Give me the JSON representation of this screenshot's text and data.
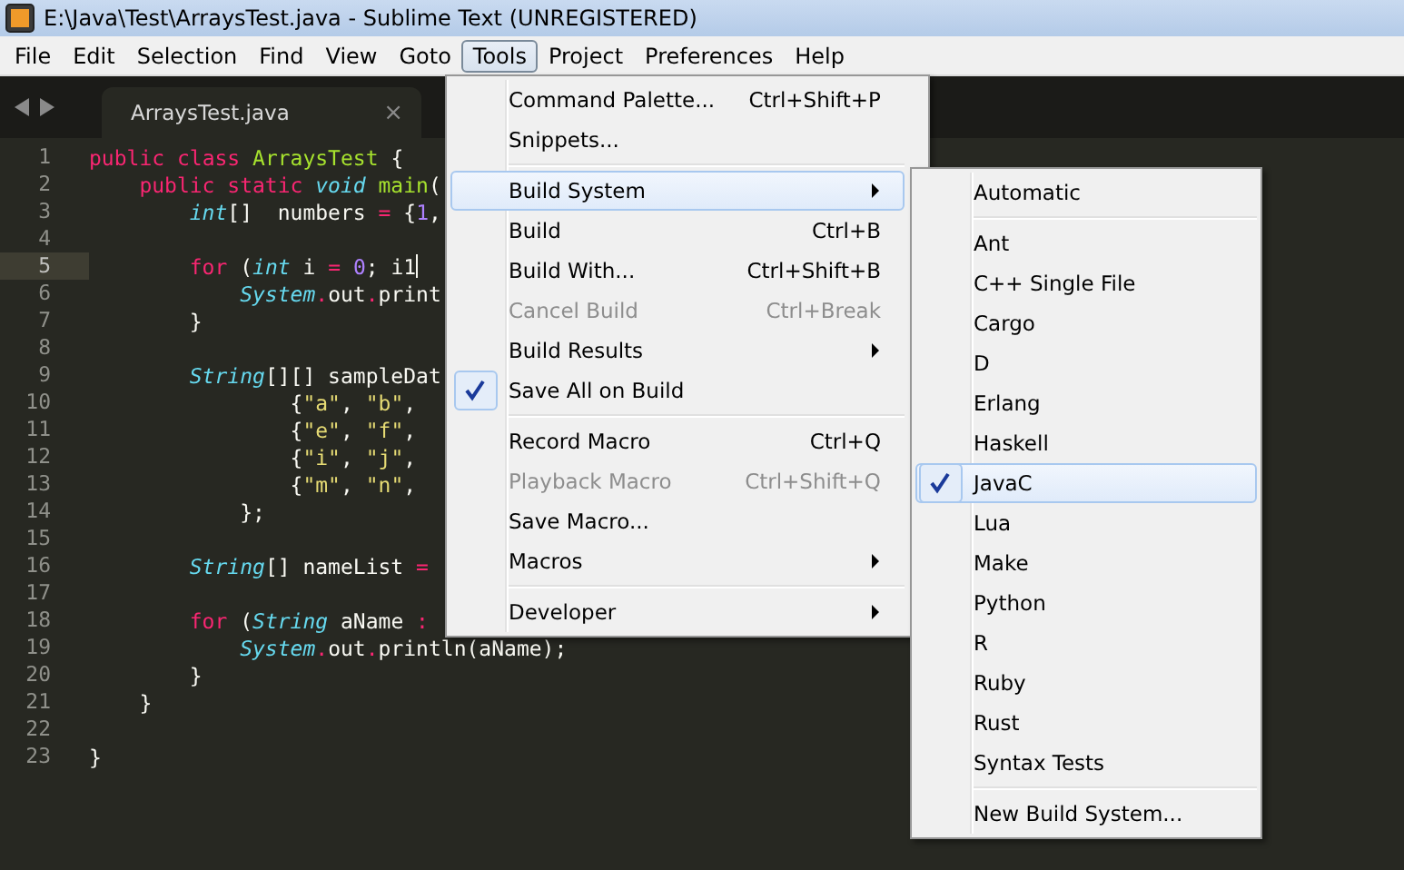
{
  "window": {
    "title": "E:\\Java\\Test\\ArraysTest.java - Sublime Text (UNREGISTERED)"
  },
  "menubar": [
    {
      "label": "File",
      "selected": false
    },
    {
      "label": "Edit",
      "selected": false
    },
    {
      "label": "Selection",
      "selected": false
    },
    {
      "label": "Find",
      "selected": false
    },
    {
      "label": "View",
      "selected": false
    },
    {
      "label": "Goto",
      "selected": false
    },
    {
      "label": "Tools",
      "selected": true
    },
    {
      "label": "Project",
      "selected": false
    },
    {
      "label": "Preferences",
      "selected": false
    },
    {
      "label": "Help",
      "selected": false
    }
  ],
  "tabs": [
    {
      "label": "ArraysTest.java",
      "selected": true,
      "close": "×"
    }
  ],
  "editor": {
    "lines": [
      {
        "number": "1",
        "current": false,
        "tokens": [
          {
            "kind": "kw",
            "text": "public"
          },
          {
            "kind": "kw",
            "text": " class"
          },
          {
            "kind": "fn",
            "text": " ArraysTest"
          },
          {
            "kind": "plain",
            "text": " {"
          }
        ]
      },
      {
        "number": "2",
        "current": false,
        "tokens": [
          {
            "kind": "kw",
            "text": "    public static"
          },
          {
            "kind": "type",
            "text": " void"
          },
          {
            "kind": "fn",
            "text": " main"
          },
          {
            "kind": "plain",
            "text": "("
          }
        ]
      },
      {
        "number": "3",
        "current": false,
        "tokens": [
          {
            "kind": "type",
            "text": "        int"
          },
          {
            "kind": "plain",
            "text": "[]  numbers"
          },
          {
            "kind": "kw",
            "text": " ="
          },
          {
            "kind": "plain",
            "text": " {"
          },
          {
            "kind": "num",
            "text": "1"
          },
          {
            "kind": "plain",
            "text": ","
          }
        ]
      },
      {
        "number": "4",
        "current": false
      },
      {
        "number": "5",
        "current": true,
        "tokens": [
          {
            "kind": "kw",
            "text": "        for"
          },
          {
            "kind": "plain",
            "text": " ("
          },
          {
            "kind": "type",
            "text": "int"
          },
          {
            "kind": "plain",
            "text": " i"
          },
          {
            "kind": "kw",
            "text": " ="
          },
          {
            "kind": "num",
            "text": " 0"
          },
          {
            "kind": "plain",
            "text": "; i1"
          }
        ]
      },
      {
        "number": "6",
        "current": false,
        "tokens": [
          {
            "kind": "type",
            "text": "            System"
          },
          {
            "kind": "kw",
            "text": "."
          },
          {
            "kind": "plain",
            "text": "out"
          },
          {
            "kind": "kw",
            "text": "."
          },
          {
            "kind": "plain",
            "text": "print"
          }
        ]
      },
      {
        "number": "7",
        "current": false,
        "tokens": [
          {
            "kind": "plain",
            "text": "        }"
          }
        ]
      },
      {
        "number": "8",
        "current": false
      },
      {
        "number": "9",
        "current": false,
        "tokens": [
          {
            "kind": "type",
            "text": "        String"
          },
          {
            "kind": "plain",
            "text": "[][] sampleDat"
          }
        ]
      },
      {
        "number": "10",
        "current": false,
        "tokens": [
          {
            "kind": "plain",
            "text": "                {"
          },
          {
            "kind": "str",
            "text": "\"a\""
          },
          {
            "kind": "plain",
            "text": ", "
          },
          {
            "kind": "str",
            "text": "\"b\""
          },
          {
            "kind": "plain",
            "text": ","
          }
        ]
      },
      {
        "number": "11",
        "current": false,
        "tokens": [
          {
            "kind": "plain",
            "text": "                {"
          },
          {
            "kind": "str",
            "text": "\"e\""
          },
          {
            "kind": "plain",
            "text": ", "
          },
          {
            "kind": "str",
            "text": "\"f\""
          },
          {
            "kind": "plain",
            "text": ","
          }
        ]
      },
      {
        "number": "12",
        "current": false,
        "tokens": [
          {
            "kind": "plain",
            "text": "                {"
          },
          {
            "kind": "str",
            "text": "\"i\""
          },
          {
            "kind": "plain",
            "text": ", "
          },
          {
            "kind": "str",
            "text": "\"j\""
          },
          {
            "kind": "plain",
            "text": ","
          }
        ]
      },
      {
        "number": "13",
        "current": false,
        "tokens": [
          {
            "kind": "plain",
            "text": "                {"
          },
          {
            "kind": "str",
            "text": "\"m\""
          },
          {
            "kind": "plain",
            "text": ", "
          },
          {
            "kind": "str",
            "text": "\"n\""
          },
          {
            "kind": "plain",
            "text": ","
          }
        ]
      },
      {
        "number": "14",
        "current": false,
        "tokens": [
          {
            "kind": "plain",
            "text": "            };"
          }
        ]
      },
      {
        "number": "15",
        "current": false
      },
      {
        "number": "16",
        "current": false,
        "tokens": [
          {
            "kind": "type",
            "text": "        String"
          },
          {
            "kind": "plain",
            "text": "[] nameList"
          },
          {
            "kind": "kw",
            "text": " ="
          }
        ]
      },
      {
        "number": "17",
        "current": false
      },
      {
        "number": "18",
        "current": false,
        "tokens": [
          {
            "kind": "kw",
            "text": "        for"
          },
          {
            "kind": "plain",
            "text": " ("
          },
          {
            "kind": "type",
            "text": "String"
          },
          {
            "kind": "plain",
            "text": " aName"
          },
          {
            "kind": "kw",
            "text": " :"
          }
        ]
      },
      {
        "number": "19",
        "current": false,
        "tokens": [
          {
            "kind": "type",
            "text": "            System"
          },
          {
            "kind": "kw",
            "text": "."
          },
          {
            "kind": "plain",
            "text": "out"
          },
          {
            "kind": "kw",
            "text": "."
          },
          {
            "kind": "plain",
            "text": "println(aName);"
          }
        ]
      },
      {
        "number": "20",
        "current": false,
        "tokens": [
          {
            "kind": "plain",
            "text": "        }"
          }
        ]
      },
      {
        "number": "21",
        "current": false,
        "tokens": [
          {
            "kind": "plain",
            "text": "    }"
          }
        ]
      },
      {
        "number": "22",
        "current": false
      },
      {
        "number": "23",
        "current": false,
        "tokens": [
          {
            "kind": "plain",
            "text": "}"
          }
        ]
      }
    ]
  },
  "tools_menu": [
    {
      "kind": "item",
      "label": "Command Palette...",
      "shortcut": "Ctrl+Shift+P",
      "disabled": false,
      "checked": false,
      "submenu": false,
      "selected": false
    },
    {
      "kind": "item",
      "label": "Snippets...",
      "disabled": false,
      "checked": false,
      "submenu": false,
      "selected": false
    },
    {
      "kind": "separator"
    },
    {
      "kind": "item",
      "label": "Build System",
      "disabled": false,
      "checked": false,
      "submenu": true,
      "selected": true
    },
    {
      "kind": "item",
      "label": "Build",
      "shortcut": "Ctrl+B",
      "disabled": false,
      "checked": false,
      "submenu": false,
      "selected": false
    },
    {
      "kind": "item",
      "label": "Build With...",
      "shortcut": "Ctrl+Shift+B",
      "disabled": false,
      "checked": false,
      "submenu": false,
      "selected": false
    },
    {
      "kind": "item",
      "label": "Cancel Build",
      "shortcut": "Ctrl+Break",
      "disabled": true,
      "checked": false,
      "submenu": false,
      "selected": false
    },
    {
      "kind": "item",
      "label": "Build Results",
      "disabled": false,
      "checked": false,
      "submenu": true,
      "selected": false
    },
    {
      "kind": "item",
      "label": "Save All on Build",
      "disabled": false,
      "checked": true,
      "submenu": false,
      "selected": false
    },
    {
      "kind": "separator"
    },
    {
      "kind": "item",
      "label": "Record Macro",
      "shortcut": "Ctrl+Q",
      "disabled": false,
      "checked": false,
      "submenu": false,
      "selected": false
    },
    {
      "kind": "item",
      "label": "Playback Macro",
      "shortcut": "Ctrl+Shift+Q",
      "disabled": true,
      "checked": false,
      "submenu": false,
      "selected": false
    },
    {
      "kind": "item",
      "label": "Save Macro...",
      "disabled": false,
      "checked": false,
      "submenu": false,
      "selected": false
    },
    {
      "kind": "item",
      "label": "Macros",
      "disabled": false,
      "checked": false,
      "submenu": true,
      "selected": false
    },
    {
      "kind": "separator"
    },
    {
      "kind": "item",
      "label": "Developer",
      "disabled": false,
      "checked": false,
      "submenu": true,
      "selected": false
    }
  ],
  "build_system_menu": [
    {
      "kind": "item",
      "label": "Automatic",
      "checked": false,
      "selected": false
    },
    {
      "kind": "separator"
    },
    {
      "kind": "item",
      "label": "Ant",
      "checked": false,
      "selected": false
    },
    {
      "kind": "item",
      "label": "C++ Single File",
      "checked": false,
      "selected": false
    },
    {
      "kind": "item",
      "label": "Cargo",
      "checked": false,
      "selected": false
    },
    {
      "kind": "item",
      "label": "D",
      "checked": false,
      "selected": false
    },
    {
      "kind": "item",
      "label": "Erlang",
      "checked": false,
      "selected": false
    },
    {
      "kind": "item",
      "label": "Haskell",
      "checked": false,
      "selected": false
    },
    {
      "kind": "item",
      "label": "JavaC",
      "checked": true,
      "selected": true
    },
    {
      "kind": "item",
      "label": "Lua",
      "checked": false,
      "selected": false
    },
    {
      "kind": "item",
      "label": "Make",
      "checked": false,
      "selected": false
    },
    {
      "kind": "item",
      "label": "Python",
      "checked": false,
      "selected": false
    },
    {
      "kind": "item",
      "label": "R",
      "checked": false,
      "selected": false
    },
    {
      "kind": "item",
      "label": "Ruby",
      "checked": false,
      "selected": false
    },
    {
      "kind": "item",
      "label": "Rust",
      "checked": false,
      "selected": false
    },
    {
      "kind": "item",
      "label": "Syntax Tests",
      "checked": false,
      "selected": false
    },
    {
      "kind": "separator"
    },
    {
      "kind": "item",
      "label": "New Build System...",
      "checked": false,
      "selected": false
    }
  ]
}
